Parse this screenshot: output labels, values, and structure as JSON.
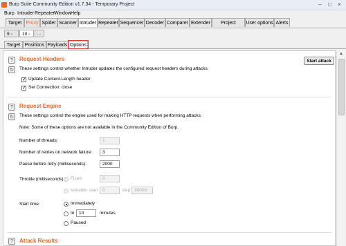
{
  "window": {
    "title": "Burp Suite Community Edition v1.7.34 - Temporary Project"
  },
  "menu": [
    "Burp",
    "Intruder",
    "Repeater",
    "Window",
    "Help"
  ],
  "main_tabs": [
    "Target",
    "Proxy",
    "Spider",
    "Scanner",
    "Intruder",
    "Repeater",
    "Sequencer",
    "Decoder",
    "Comparer",
    "Extender",
    "Project options",
    "User options",
    "Alerts"
  ],
  "attack_tabs": [
    "9",
    "10",
    "..."
  ],
  "sub_tabs": [
    "Target",
    "Positions",
    "Payloads",
    "Options"
  ],
  "request_headers": {
    "heading": "Request Headers",
    "description": "These settings control whether Intruder updates the configured request headers during attacks.",
    "update_content_length": {
      "label": "Update Content-Length header",
      "checked": true
    },
    "set_connection_close": {
      "label": "Set Connection: close",
      "checked": true
    },
    "start_attack_label": "Start attack"
  },
  "request_engine": {
    "heading": "Request Engine",
    "description": "These settings control the engine used for making HTTP requests when performing attacks.",
    "note": "Note: Some of these options are not available in the Community Edition of Burp.",
    "threads": {
      "label": "Number of threads:",
      "value": "1"
    },
    "retries": {
      "label": "Number of retries on network failure:",
      "value": "3"
    },
    "pause": {
      "label": "Pause before retry (milliseconds):",
      "value": "2000"
    },
    "throttle": {
      "label": "Throttle (milliseconds):",
      "fixed_label": "Fixed",
      "fixed_value": "0",
      "variable_label": "Variable: start",
      "variable_start": "0",
      "step_label": "step",
      "step_value": "30000"
    },
    "start_time": {
      "label": "Start time:",
      "immediately": "Immediately",
      "in_label": "In",
      "in_value": "10",
      "minutes": "minutes",
      "paused": "Paused"
    }
  },
  "attack_results": {
    "heading": "Attack Results"
  },
  "colors": {
    "accent": "#e8692a",
    "selected_outline": "#e03a3a"
  }
}
